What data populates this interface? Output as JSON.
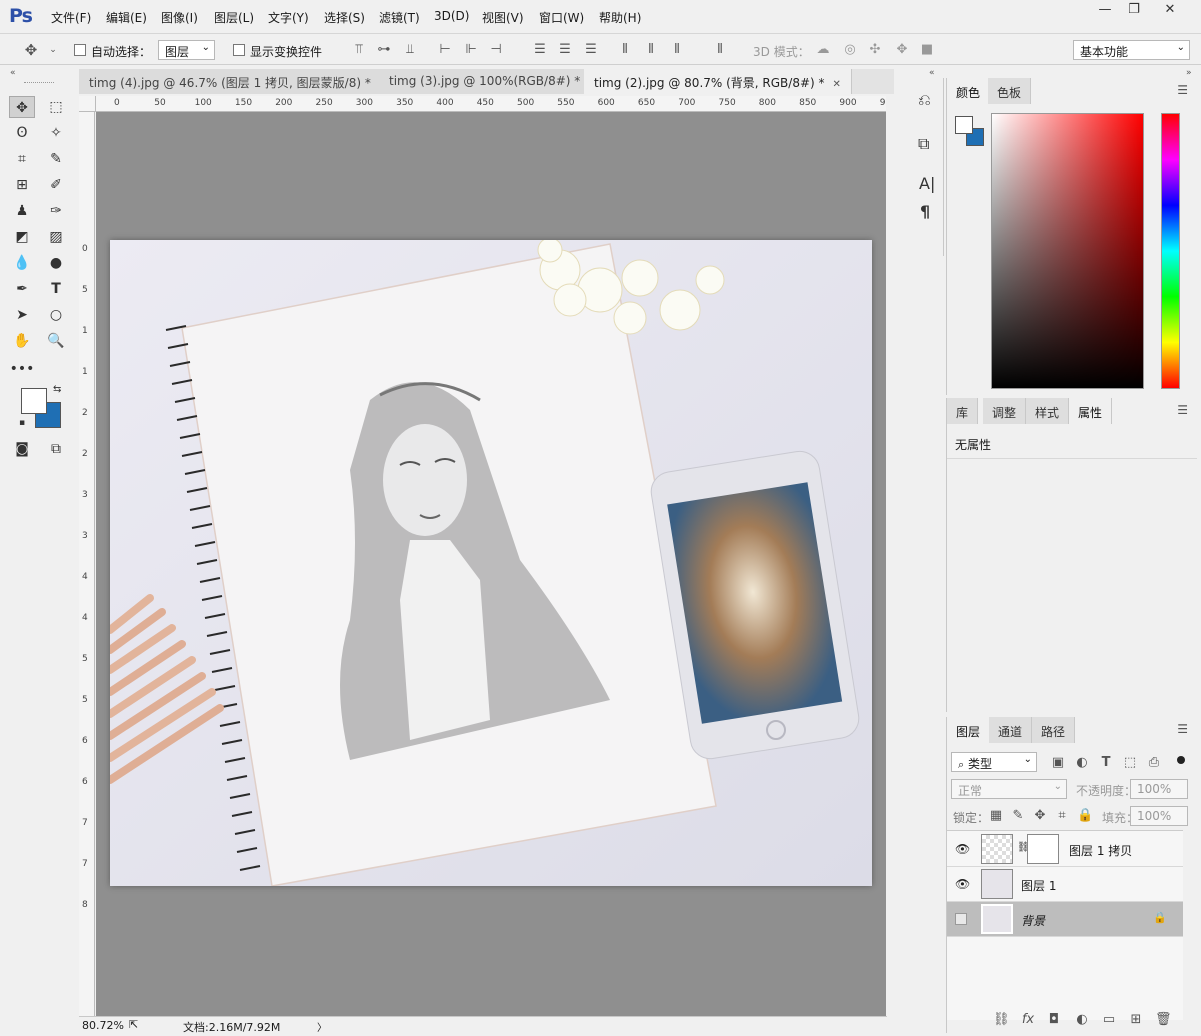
{
  "app": {
    "logo": "Ps",
    "menu": [
      "文件(F)",
      "编辑(E)",
      "图像(I)",
      "图层(L)",
      "文字(Y)",
      "选择(S)",
      "滤镜(T)",
      "3D(D)",
      "视图(V)",
      "窗口(W)",
      "帮助(H)"
    ],
    "window_buttons": {
      "minimize": "—",
      "restore": "❐",
      "close": "✕"
    }
  },
  "options": {
    "auto_select_label": "自动选择：",
    "auto_select_value": "图层",
    "show_transform_label": "显示变换控件",
    "mode3d_label": "3D 模式：",
    "workspace": "基本功能"
  },
  "tabs": [
    {
      "label": "timg (4).jpg @ 46.7% (图层 1 拷贝, 图层蒙版/8) *",
      "close": "✕"
    },
    {
      "label": "timg (3).jpg @ 100%(RGB/8#) *",
      "close": "✕"
    },
    {
      "label": "timg (2).jpg @ 80.7% (背景, RGB/8#) *",
      "close": "✕"
    }
  ],
  "ruler": {
    "h_ticks": [
      "0",
      "50",
      "100",
      "150",
      "200",
      "250",
      "300",
      "350",
      "400",
      "450",
      "500",
      "550",
      "600",
      "650",
      "700",
      "750",
      "800",
      "850",
      "900",
      "9"
    ],
    "v_ticks": [
      "0",
      "5",
      "1",
      "1",
      "2",
      "2",
      "3",
      "3",
      "4",
      "4",
      "5",
      "5",
      "6",
      "6",
      "7",
      "7",
      "8"
    ]
  },
  "status": {
    "zoom": "80.72%",
    "doc": "文档:2.16M/7.92M",
    "arrow": "〉"
  },
  "color_panel": {
    "tabs": [
      "颜色",
      "色板"
    ],
    "fg": "#ffffff",
    "bg": "#1f6fb4"
  },
  "props_panel": {
    "tabs": [
      "库",
      "调整",
      "样式",
      "属性"
    ],
    "content": "无属性"
  },
  "layers_panel": {
    "tabs": [
      "图层",
      "通道",
      "路径"
    ],
    "filter": "类型",
    "blend": "正常",
    "opacity_label": "不透明度：",
    "opacity": "100%",
    "lock_label": "锁定：",
    "fill_label": "填充：",
    "fill": "100%",
    "layers": [
      {
        "name": "图层 1 拷贝",
        "visible": true,
        "selected": false
      },
      {
        "name": "图层 1",
        "visible": true,
        "selected": false
      },
      {
        "name": "背景",
        "visible": false,
        "selected": true,
        "locked": true
      }
    ]
  },
  "right_strip": {
    "items": [
      "history",
      "properties-3d",
      "A|",
      "¶"
    ]
  }
}
